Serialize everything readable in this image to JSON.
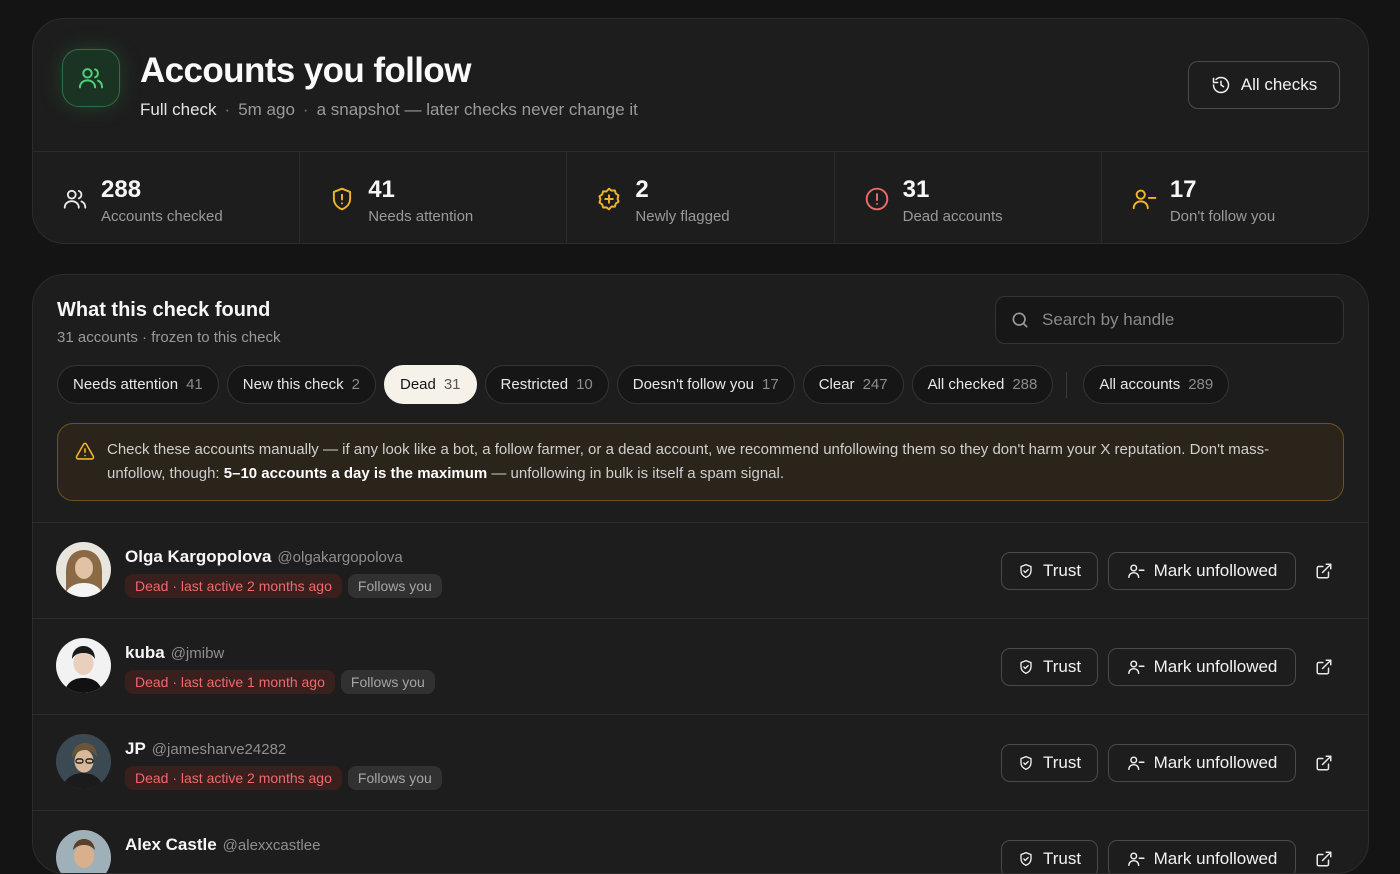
{
  "header": {
    "title": "Accounts you follow",
    "check_type": "Full check",
    "time_ago": "5m ago",
    "note": "a snapshot — later checks never change it",
    "all_checks_label": "All checks"
  },
  "stats": [
    {
      "value": "288",
      "label": "Accounts checked",
      "icon": "users-icon"
    },
    {
      "value": "41",
      "label": "Needs attention",
      "icon": "shield-alert-icon"
    },
    {
      "value": "2",
      "label": "Newly flagged",
      "icon": "badge-plus-icon"
    },
    {
      "value": "31",
      "label": "Dead accounts",
      "icon": "alert-circle-icon"
    },
    {
      "value": "17",
      "label": "Don't follow you",
      "icon": "user-minus-icon"
    }
  ],
  "findings": {
    "title": "What this check found",
    "subtitle": "31 accounts · frozen to this check",
    "search_placeholder": "Search by handle",
    "filters": [
      {
        "label": "Needs attention",
        "count": "41"
      },
      {
        "label": "New this check",
        "count": "2"
      },
      {
        "label": "Dead",
        "count": "31",
        "active": true
      },
      {
        "label": "Restricted",
        "count": "10"
      },
      {
        "label": "Doesn't follow you",
        "count": "17"
      },
      {
        "label": "Clear",
        "count": "247"
      },
      {
        "label": "All checked",
        "count": "288"
      }
    ],
    "all_accounts": {
      "label": "All accounts",
      "count": "289"
    },
    "notice": {
      "text_before": "Check these accounts manually — if any look like a bot, a follow farmer, or a dead account, we recommend unfollowing them so they don't harm your X reputation. Don't mass-unfollow, though: ",
      "emphasis": "5–10 accounts a day is the maximum",
      "text_after": " — unfollowing in bulk is itself a spam signal."
    }
  },
  "accounts": [
    {
      "name": "Olga Kargopolova",
      "handle": "@olgakargopolova",
      "status": "Dead · last active 2 months ago",
      "follows": "Follows you",
      "trust": "Trust",
      "unfollow": "Mark unfollowed"
    },
    {
      "name": "kuba",
      "handle": "@jmibw",
      "status": "Dead · last active 1 month ago",
      "follows": "Follows you",
      "trust": "Trust",
      "unfollow": "Mark unfollowed"
    },
    {
      "name": "JP",
      "handle": "@jamesharve24282",
      "status": "Dead · last active 2 months ago",
      "follows": "Follows you",
      "trust": "Trust",
      "unfollow": "Mark unfollowed"
    },
    {
      "name": "Alex Castle",
      "handle": "@alexxcastlee",
      "status": "",
      "follows": "",
      "trust": "Trust",
      "unfollow": "Mark unfollowed"
    }
  ],
  "colors": {
    "accent_green": "#4fcf7a",
    "warning_yellow": "#f0b429",
    "danger_red": "#ee6a6a",
    "active_chip_bg": "#f6f2ea"
  }
}
